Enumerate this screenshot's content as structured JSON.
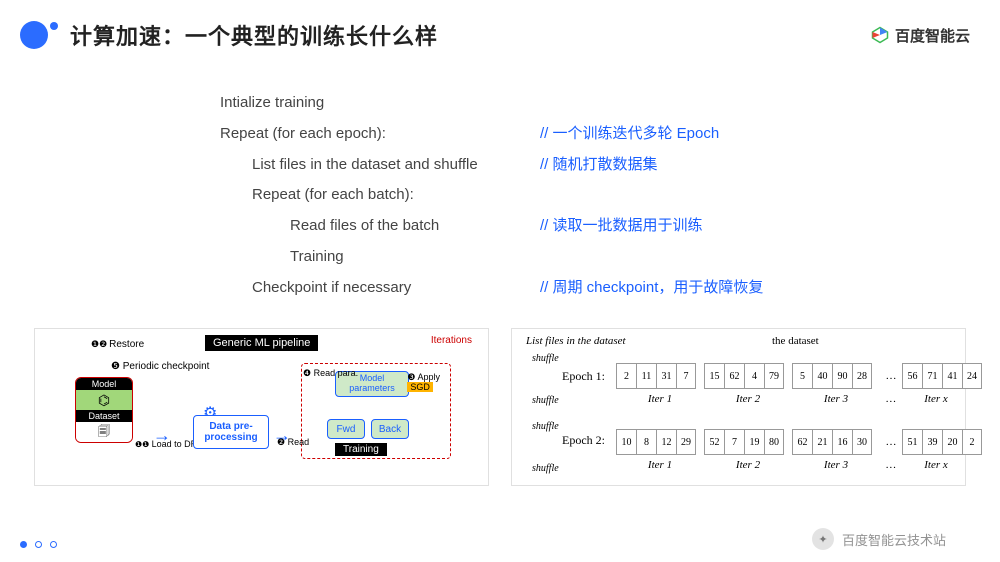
{
  "header": {
    "title": "计算加速：一个典型的训练长什么样",
    "brand": "百度智能云"
  },
  "pseudo": {
    "l1": "Intialize training",
    "l2": "Repeat (for each epoch):",
    "c2": "// 一个训练迭代多轮 Epoch",
    "l3": "List files in the dataset and shuffle",
    "c3": "// 随机打散数据集",
    "l4": "Repeat (for each batch):",
    "l5": "Read files of the batch",
    "c5": "// 读取一批数据用于训练",
    "l6": "Training",
    "l7": "Checkpoint if necessary",
    "c7": "// 周期 checkpoint，用于故障恢复"
  },
  "pipeline": {
    "title": "Generic ML pipeline",
    "iterations": "Iterations",
    "restore": "Restore",
    "periodic": "Periodic checkpoint",
    "model": "Model",
    "dataset": "Dataset",
    "load": "Load to DRAM",
    "preprocess": "Data pre-processing",
    "model_params": "Model parameters",
    "read_para": "Read para.",
    "apply": "Apply",
    "sgd": "SGD",
    "fwd": "Fwd",
    "back": "Back",
    "training": "Training",
    "read": "Read"
  },
  "epochs": {
    "list_label": "List files in the dataset",
    "dataset_label": "the dataset",
    "shuffle": "shuffle",
    "epoch1_label": "Epoch 1:",
    "epoch2_label": "Epoch 2:",
    "iter_prefix": "Iter",
    "iter_x": "Iter x",
    "row1": {
      "g1": [
        "2",
        "11",
        "31",
        "7"
      ],
      "g2": [
        "15",
        "62",
        "4",
        "79"
      ],
      "g3": [
        "5",
        "40",
        "90",
        "28"
      ],
      "gx": [
        "56",
        "71",
        "41",
        "24"
      ]
    },
    "row2": {
      "g1": [
        "10",
        "8",
        "12",
        "29"
      ],
      "g2": [
        "52",
        "7",
        "19",
        "80"
      ],
      "g3": [
        "62",
        "21",
        "16",
        "30"
      ],
      "gx": [
        "51",
        "39",
        "20",
        "2"
      ]
    }
  },
  "watermark": "百度智能云技术站"
}
